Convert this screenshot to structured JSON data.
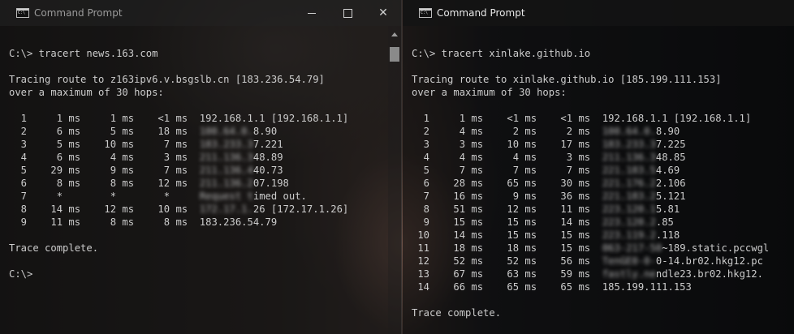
{
  "left": {
    "title": "Command Prompt",
    "lines": [
      "C:\\> tracert news.163.com",
      "",
      "Tracing route to z163ipv6.v.bsgslb.cn [183.236.54.79]",
      "over a maximum of 30 hops:",
      "",
      [
        {
          "t": "  1     1 ms     1 ms    <1 ms  192.168.1.1 [192.168.1.1]"
        }
      ],
      [
        {
          "t": "  2     6 ms     5 ms    18 ms  "
        },
        {
          "t": "100.64.0.",
          "b": true
        },
        {
          "t": "8.90"
        }
      ],
      [
        {
          "t": "  3     5 ms    10 ms     7 ms  "
        },
        {
          "t": "183.233.3",
          "b": true
        },
        {
          "t": "7.221"
        }
      ],
      [
        {
          "t": "  4     6 ms     4 ms     3 ms  "
        },
        {
          "t": "211.136.3",
          "b": true
        },
        {
          "t": "48.89"
        }
      ],
      [
        {
          "t": "  5    29 ms     9 ms     7 ms  "
        },
        {
          "t": "211.136.4",
          "b": true
        },
        {
          "t": "40.73"
        }
      ],
      [
        {
          "t": "  6     8 ms     8 ms    12 ms  "
        },
        {
          "t": "211.136.2",
          "b": true
        },
        {
          "t": "07.198"
        }
      ],
      [
        {
          "t": "  7     *        *        *     "
        },
        {
          "t": "Request t",
          "b": true
        },
        {
          "t": "imed out."
        }
      ],
      [
        {
          "t": "  8    14 ms    12 ms    10 ms  "
        },
        {
          "t": "172.17.1.",
          "b": true
        },
        {
          "t": "26 [172.17.1.26]"
        }
      ],
      [
        {
          "t": "  9    11 ms     8 ms     8 ms  183.236.54.79"
        }
      ],
      "",
      "Trace complete.",
      "",
      "C:\\>"
    ]
  },
  "right": {
    "title": "Command Prompt",
    "lines": [
      "C:\\> tracert xinlake.github.io",
      "",
      "Tracing route to xinlake.github.io [185.199.111.153]",
      "over a maximum of 30 hops:",
      "",
      [
        {
          "t": "  1     1 ms    <1 ms    <1 ms  192.168.1.1 [192.168.1.1]"
        }
      ],
      [
        {
          "t": "  2     4 ms     2 ms     2 ms  "
        },
        {
          "t": "100.64.0.",
          "b": true
        },
        {
          "t": "8.90"
        }
      ],
      [
        {
          "t": "  3     3 ms    10 ms    17 ms  "
        },
        {
          "t": "183.233.3",
          "b": true
        },
        {
          "t": "7.225"
        }
      ],
      [
        {
          "t": "  4     4 ms     4 ms     3 ms  "
        },
        {
          "t": "211.136.3",
          "b": true
        },
        {
          "t": "48.85"
        }
      ],
      [
        {
          "t": "  5     7 ms     7 ms     7 ms  "
        },
        {
          "t": "221.183.5",
          "b": true
        },
        {
          "t": "4.69"
        }
      ],
      [
        {
          "t": "  6    28 ms    65 ms    30 ms  "
        },
        {
          "t": "221.176.2",
          "b": true
        },
        {
          "t": "2.106"
        }
      ],
      [
        {
          "t": "  7    16 ms     9 ms    36 ms  "
        },
        {
          "t": "221.183.2",
          "b": true
        },
        {
          "t": "5.121"
        }
      ],
      [
        {
          "t": "  8    51 ms    12 ms    11 ms  "
        },
        {
          "t": "223.120.1",
          "b": true
        },
        {
          "t": "5.81"
        }
      ],
      [
        {
          "t": "  9    15 ms    15 ms    14 ms  "
        },
        {
          "t": "223.120.2",
          "b": true
        },
        {
          "t": ".85"
        }
      ],
      [
        {
          "t": " 10    14 ms    15 ms    15 ms  "
        },
        {
          "t": "223.119.2",
          "b": true
        },
        {
          "t": ".118"
        }
      ],
      [
        {
          "t": " 11    18 ms    18 ms    15 ms  "
        },
        {
          "t": "063-217-50",
          "b": true
        },
        {
          "t": "~189.static.pccwgl"
        }
      ],
      [
        {
          "t": " 12    52 ms    52 ms    56 ms  "
        },
        {
          "t": "TenGE0-0-",
          "b": true
        },
        {
          "t": "0-14.br02.hkg12.pc"
        }
      ],
      [
        {
          "t": " 13    67 ms    63 ms    59 ms  "
        },
        {
          "t": "fastly.ne",
          "b": true
        },
        {
          "t": "ndle23.br02.hkg12."
        }
      ],
      [
        {
          "t": " 14    66 ms    65 ms    65 ms  185.199.111.153"
        }
      ],
      "",
      "Trace complete."
    ]
  },
  "controls": {
    "minimize": "minimize",
    "maximize": "maximize",
    "close": "✕"
  }
}
